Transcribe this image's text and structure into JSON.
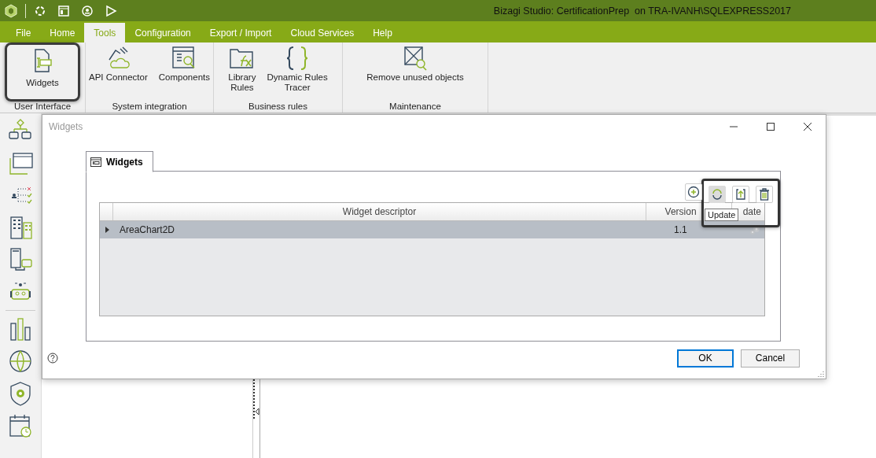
{
  "title_bar": {
    "title": "Bizagi Studio: CertificationPrep  on TRA-IVANH\\SQLEXPRESS2017"
  },
  "menu_tabs": [
    {
      "label": "File",
      "selected": false
    },
    {
      "label": "Home",
      "selected": false
    },
    {
      "label": "Tools",
      "selected": true
    },
    {
      "label": "Configuration",
      "selected": false
    },
    {
      "label": "Export / Import",
      "selected": false
    },
    {
      "label": "Cloud Services",
      "selected": false
    },
    {
      "label": "Help",
      "selected": false
    }
  ],
  "ribbon": {
    "groups": [
      {
        "label": "User Interface",
        "items": [
          {
            "kind": "widgets",
            "lines": [
              "Widgets"
            ],
            "highlighted": true
          }
        ]
      },
      {
        "label": "System integration",
        "items": [
          {
            "kind": "connector",
            "lines": [
              "API Connector"
            ],
            "highlighted": false
          },
          {
            "kind": "components",
            "lines": [
              "Components"
            ],
            "highlighted": false
          }
        ]
      },
      {
        "label": "Business rules",
        "items": [
          {
            "kind": "library",
            "lines": [
              "Library",
              "Rules"
            ],
            "highlighted": false
          },
          {
            "kind": "braces",
            "lines": [
              "Dynamic Rules",
              "Tracer"
            ],
            "highlighted": false
          }
        ]
      },
      {
        "label": "Maintenance",
        "items": [
          {
            "kind": "remove",
            "lines": [
              "Remove unused objects"
            ],
            "highlighted": false
          }
        ]
      }
    ]
  },
  "dialog": {
    "title": "Widgets",
    "tab": {
      "label": "Widgets",
      "selected": true
    },
    "toolbar": [
      {
        "kind": "add",
        "hovered": false,
        "boxed": false
      },
      {
        "kind": "update",
        "hovered": true,
        "boxed": true
      },
      {
        "kind": "upload",
        "hovered": false,
        "boxed": true
      },
      {
        "kind": "delete",
        "hovered": false,
        "boxed": true
      }
    ],
    "tooltip": "Update",
    "table": {
      "columns": [
        "Widget descriptor",
        "Version",
        "date"
      ],
      "rows": [
        {
          "expanded": false,
          "selected": true,
          "cells": [
            "AreaChart2D",
            "1.1"
          ]
        }
      ]
    },
    "buttons": [
      {
        "label": "OK",
        "default": true
      },
      {
        "label": "Cancel",
        "default": false
      }
    ]
  }
}
